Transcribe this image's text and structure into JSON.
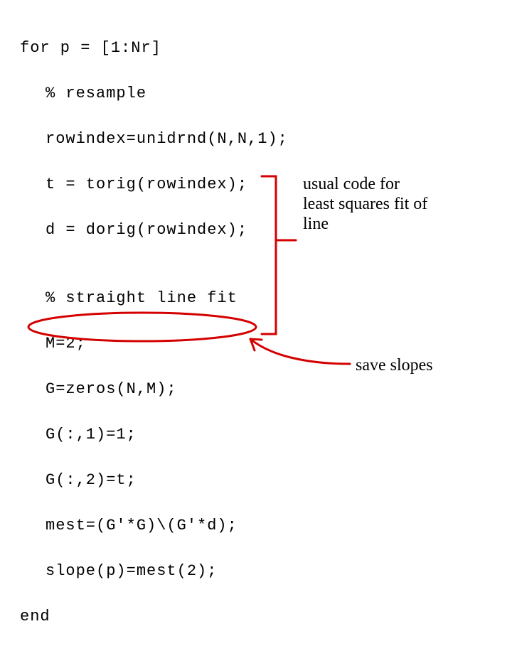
{
  "code": {
    "l0": "for p = [1:Nr]",
    "l1": "% resample",
    "l2": "rowindex=unidrnd(N,N,1);",
    "l3": "t = torig(rowindex);",
    "l4": "d = dorig(rowindex);",
    "l5": "",
    "l6": "% straight line fit",
    "l7": "M=2;",
    "l8": "G=zeros(N,M);",
    "l9": "G(:,1)=1;",
    "l10": "G(:,2)=t;",
    "l11": "mest=(G'*G)\\(G'*d);",
    "l12": "slope(p)=mest(2);",
    "l13": "end"
  },
  "annotations": {
    "least_squares": "usual code for least squares fit of line",
    "save_slopes": "save slopes"
  }
}
